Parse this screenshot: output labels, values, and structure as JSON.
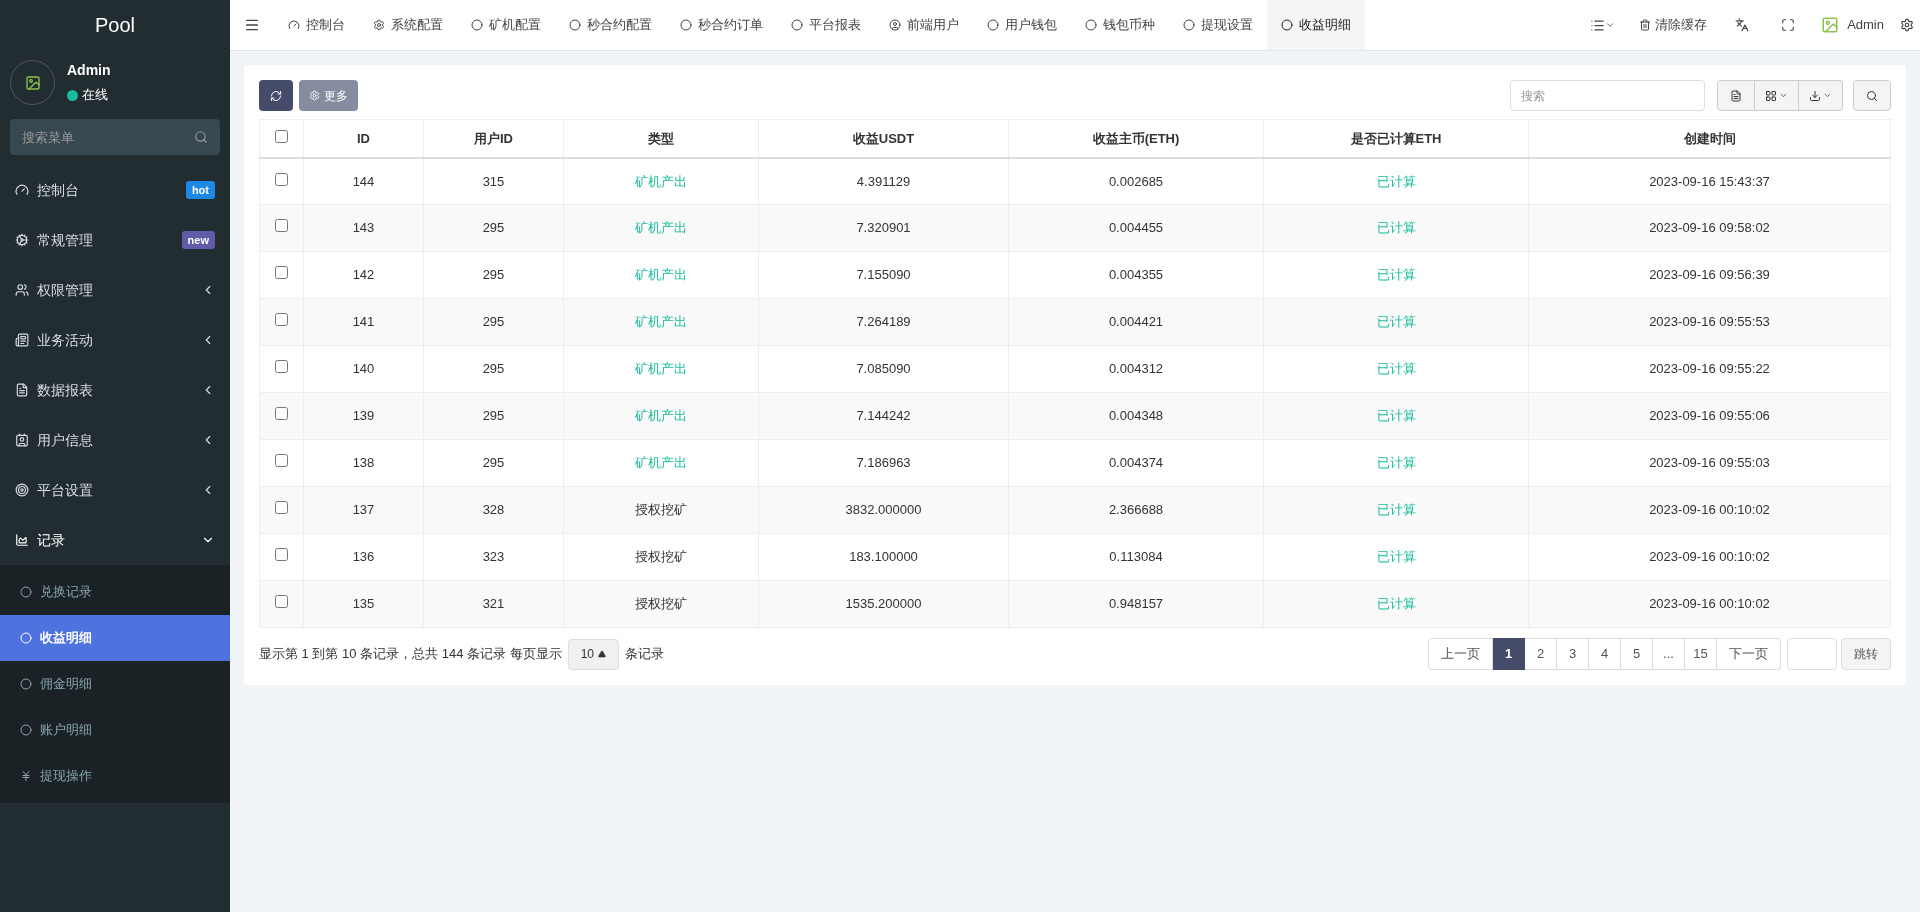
{
  "sidebar": {
    "logo": "Pool",
    "user": {
      "name": "Admin",
      "status": "在线"
    },
    "search": {
      "placeholder": "搜索菜单"
    },
    "items": [
      {
        "kind": "dashboard",
        "label": "控制台",
        "badge": {
          "text": "hot",
          "color": "#1e88e5"
        }
      },
      {
        "kind": "cogs",
        "label": "常规管理",
        "badge": {
          "text": "new",
          "color": "#605ca8"
        }
      },
      {
        "kind": "users",
        "label": "权限管理",
        "expanded": false
      },
      {
        "kind": "newspaper",
        "label": "业务活动",
        "expanded": false
      },
      {
        "kind": "file",
        "label": "数据报表",
        "expanded": false
      },
      {
        "kind": "contact",
        "label": "用户信息",
        "expanded": false
      },
      {
        "kind": "target",
        "label": "平台设置",
        "expanded": false
      },
      {
        "kind": "chart",
        "label": "记录",
        "expanded": true,
        "children": [
          {
            "kind": "circle",
            "label": "兑换记录",
            "selected": false
          },
          {
            "kind": "circle",
            "label": "收益明细",
            "selected": true
          },
          {
            "kind": "circle",
            "label": "佣金明细",
            "selected": false
          },
          {
            "kind": "circle",
            "label": "账户明细",
            "selected": false
          },
          {
            "kind": "yen",
            "label": "提现操作",
            "selected": false
          }
        ]
      }
    ]
  },
  "tabs": [
    {
      "kind": "dashboard",
      "label": "控制台",
      "selected": false
    },
    {
      "kind": "gear",
      "label": "系统配置",
      "selected": false
    },
    {
      "kind": "circle",
      "label": "矿机配置",
      "selected": false
    },
    {
      "kind": "circle",
      "label": "秒合约配置",
      "selected": false
    },
    {
      "kind": "circle",
      "label": "秒合约订单",
      "selected": false
    },
    {
      "kind": "circle",
      "label": "平台报表",
      "selected": false
    },
    {
      "kind": "user",
      "label": "前端用户",
      "selected": false
    },
    {
      "kind": "circle",
      "label": "用户钱包",
      "selected": false
    },
    {
      "kind": "circle",
      "label": "钱包币种",
      "selected": false
    },
    {
      "kind": "circle",
      "label": "提现设置",
      "selected": false
    },
    {
      "kind": "circle",
      "label": "收益明细",
      "selected": true
    }
  ],
  "topbar": {
    "clear_cache": "清除缓存",
    "user": "Admin"
  },
  "toolbar": {
    "more": "更多",
    "search": {
      "placeholder": "搜索"
    }
  },
  "table": {
    "select_all": {
      "checked": false
    },
    "columns": [
      "ID",
      "用户ID",
      "类型",
      "收益USDT",
      "收益主币(ETH)",
      "是否已计算ETH",
      "创建时间"
    ],
    "rows": [
      {
        "id": "144",
        "user_id": "315",
        "type": {
          "text": "矿机产出",
          "kind": "mining"
        },
        "usdt": "4.391129",
        "eth": "0.002685",
        "computed": "已计算",
        "time": "2023-09-16 15:43:37",
        "checked": false
      },
      {
        "id": "143",
        "user_id": "295",
        "type": {
          "text": "矿机产出",
          "kind": "mining"
        },
        "usdt": "7.320901",
        "eth": "0.004455",
        "computed": "已计算",
        "time": "2023-09-16 09:58:02",
        "checked": false
      },
      {
        "id": "142",
        "user_id": "295",
        "type": {
          "text": "矿机产出",
          "kind": "mining"
        },
        "usdt": "7.155090",
        "eth": "0.004355",
        "computed": "已计算",
        "time": "2023-09-16 09:56:39",
        "checked": false
      },
      {
        "id": "141",
        "user_id": "295",
        "type": {
          "text": "矿机产出",
          "kind": "mining"
        },
        "usdt": "7.264189",
        "eth": "0.004421",
        "computed": "已计算",
        "time": "2023-09-16 09:55:53",
        "checked": false
      },
      {
        "id": "140",
        "user_id": "295",
        "type": {
          "text": "矿机产出",
          "kind": "mining"
        },
        "usdt": "7.085090",
        "eth": "0.004312",
        "computed": "已计算",
        "time": "2023-09-16 09:55:22",
        "checked": false
      },
      {
        "id": "139",
        "user_id": "295",
        "type": {
          "text": "矿机产出",
          "kind": "mining"
        },
        "usdt": "7.144242",
        "eth": "0.004348",
        "computed": "已计算",
        "time": "2023-09-16 09:55:06",
        "checked": false
      },
      {
        "id": "138",
        "user_id": "295",
        "type": {
          "text": "矿机产出",
          "kind": "mining"
        },
        "usdt": "7.186963",
        "eth": "0.004374",
        "computed": "已计算",
        "time": "2023-09-16 09:55:03",
        "checked": false
      },
      {
        "id": "137",
        "user_id": "328",
        "type": {
          "text": "授权挖矿",
          "kind": "auth"
        },
        "usdt": "3832.000000",
        "eth": "2.366688",
        "computed": "已计算",
        "time": "2023-09-16 00:10:02",
        "checked": false
      },
      {
        "id": "136",
        "user_id": "323",
        "type": {
          "text": "授权挖矿",
          "kind": "auth"
        },
        "usdt": "183.100000",
        "eth": "0.113084",
        "computed": "已计算",
        "time": "2023-09-16 00:10:02",
        "checked": false
      },
      {
        "id": "135",
        "user_id": "321",
        "type": {
          "text": "授权挖矿",
          "kind": "auth"
        },
        "usdt": "1535.200000",
        "eth": "0.948157",
        "computed": "已计算",
        "time": "2023-09-16 00:10:02",
        "checked": false
      }
    ]
  },
  "footer": {
    "summary": "显示第 1 到第 10 条记录，总共 144 条记录 每页显示",
    "page_size": "10",
    "suffix": "条记录"
  },
  "pagination": {
    "prev": "上一页",
    "pages": [
      {
        "label": "1",
        "selected": true
      },
      {
        "label": "2",
        "selected": false
      },
      {
        "label": "3",
        "selected": false
      },
      {
        "label": "4",
        "selected": false
      },
      {
        "label": "5",
        "selected": false
      },
      {
        "label": "...",
        "selected": false
      },
      {
        "label": "15",
        "selected": false
      }
    ],
    "next": "下一页",
    "jump": "跳转"
  }
}
